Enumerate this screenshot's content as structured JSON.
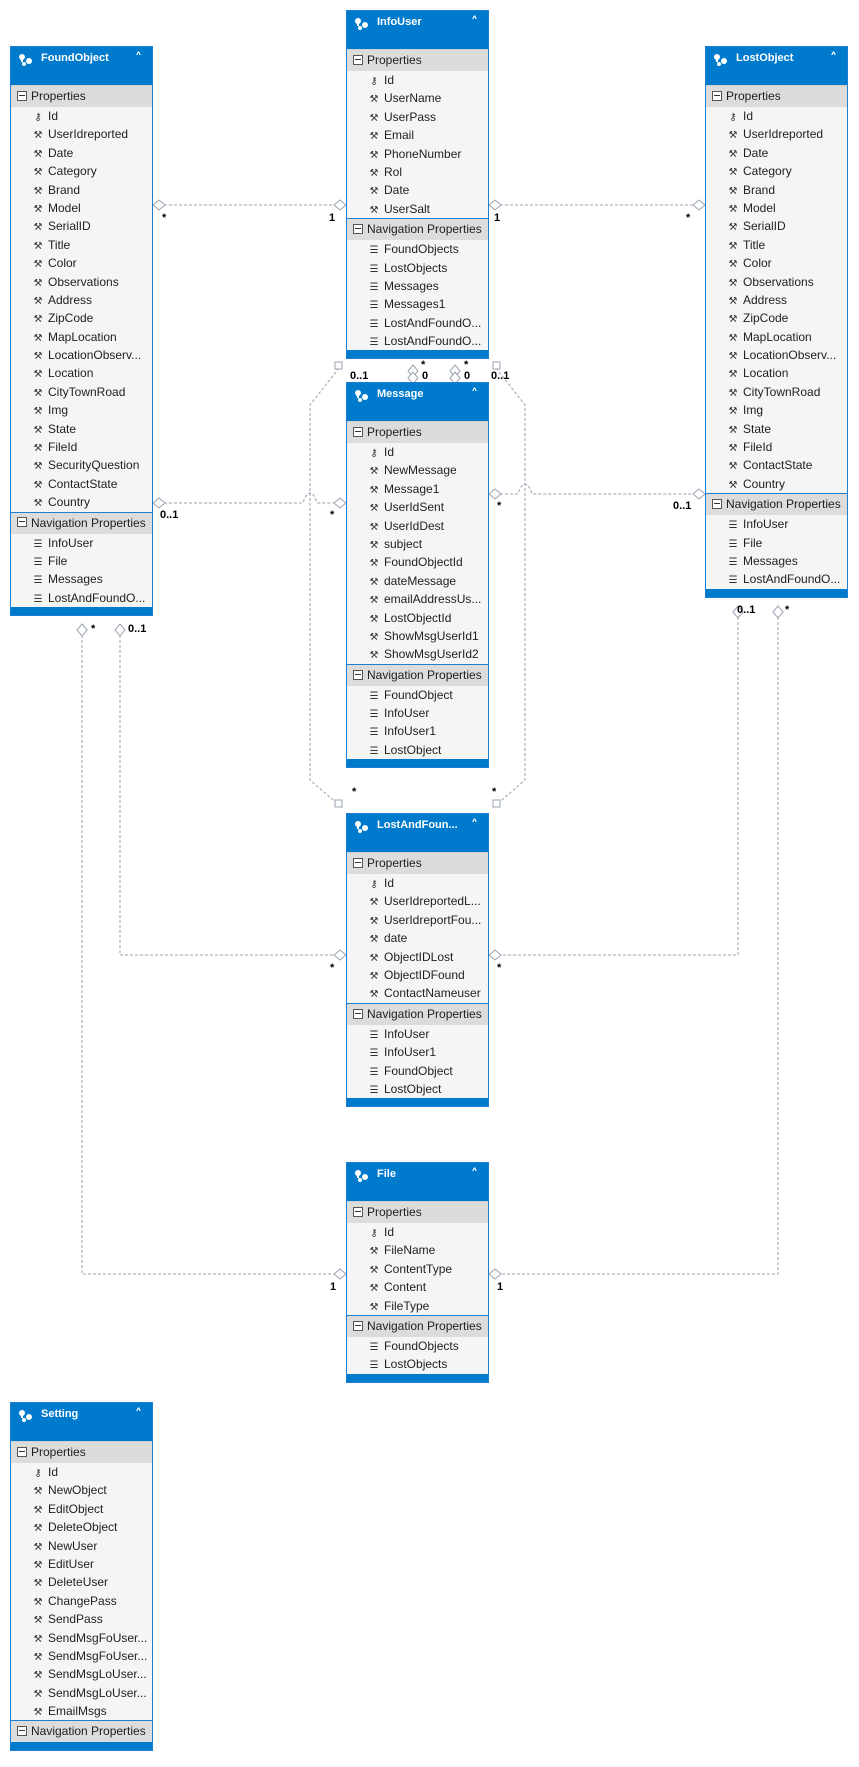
{
  "section_labels": {
    "properties": "Properties",
    "navigation": "Navigation Properties"
  },
  "colors": {
    "header": "#007acc",
    "section": "#dcdcdc",
    "body": "#f5f5f5",
    "connector": "#9aa3b0"
  },
  "entities": {
    "found_object": {
      "title": "FoundObject",
      "properties": [
        "Id",
        "UserIdreported",
        "Date",
        "Category",
        "Brand",
        "Model",
        "SerialID",
        "Title",
        "Color",
        "Observations",
        "Address",
        "ZipCode",
        "MapLocation",
        "LocationObserv...",
        "Location",
        "CityTownRoad",
        "Img",
        "State",
        "FileId",
        "SecurityQuestion",
        "ContactState",
        "Country"
      ],
      "navigation": [
        "InfoUser",
        "File",
        "Messages",
        "LostAndFoundO..."
      ]
    },
    "info_user": {
      "title": "InfoUser",
      "properties": [
        "Id",
        "UserName",
        "UserPass",
        "Email",
        "PhoneNumber",
        "Rol",
        "Date",
        "UserSalt"
      ],
      "navigation": [
        "FoundObjects",
        "LostObjects",
        "Messages",
        "Messages1",
        "LostAndFoundO...",
        "LostAndFoundO..."
      ]
    },
    "lost_object": {
      "title": "LostObject",
      "properties": [
        "Id",
        "UserIdreported",
        "Date",
        "Category",
        "Brand",
        "Model",
        "SerialID",
        "Title",
        "Color",
        "Observations",
        "Address",
        "ZipCode",
        "MapLocation",
        "LocationObserv...",
        "Location",
        "CityTownRoad",
        "Img",
        "State",
        "FileId",
        "ContactState",
        "Country"
      ],
      "navigation": [
        "InfoUser",
        "File",
        "Messages",
        "LostAndFoundO..."
      ]
    },
    "message": {
      "title": "Message",
      "properties": [
        "Id",
        "NewMessage",
        "Message1",
        "UserIdSent",
        "UserIdDest",
        "subject",
        "FoundObjectId",
        "dateMessage",
        "emailAddressUs...",
        "LostObjectId",
        "ShowMsgUserId1",
        "ShowMsgUserId2"
      ],
      "navigation": [
        "FoundObject",
        "InfoUser",
        "InfoUser1",
        "LostObject"
      ]
    },
    "lost_and_found": {
      "title": "LostAndFoun...",
      "properties": [
        "Id",
        "UserIdreportedL...",
        "UserIdreportFou...",
        "date",
        "ObjectIDLost",
        "ObjectIDFound",
        "ContactNameuser"
      ],
      "navigation": [
        "InfoUser",
        "InfoUser1",
        "FoundObject",
        "LostObject"
      ]
    },
    "file": {
      "title": "File",
      "properties": [
        "Id",
        "FileName",
        "ContentType",
        "Content",
        "FileType"
      ],
      "navigation": [
        "FoundObjects",
        "LostObjects"
      ]
    },
    "setting": {
      "title": "Setting",
      "properties": [
        "Id",
        "NewObject",
        "EditObject",
        "DeleteObject",
        "NewUser",
        "EditUser",
        "DeleteUser",
        "ChangePass",
        "SendPass",
        "SendMsgFoUser...",
        "SendMsgFoUser...",
        "SendMsgLoUser...",
        "SendMsgLoUser...",
        "EmailMsgs"
      ],
      "navigation": []
    }
  },
  "multiplicities": {
    "found_info_found": "*",
    "found_info_info": "1",
    "lost_info_info": "1",
    "lost_info_lost": "*",
    "found_msg_found": "0..1",
    "found_msg_msg": "*",
    "lost_msg_msg": "*",
    "lost_msg_lost": "0..1",
    "info_msg_a": "0..1",
    "info_msg_b_top": "*",
    "info_msg_b": "0",
    "info_msg_c_top": "*",
    "info_msg_c": "0",
    "info_msg_d": "0..1",
    "laf_left_top": "*",
    "laf_right_top": "*",
    "found_laf_found": "0..1",
    "found_laf_laf": "*",
    "lost_laf_lost": "0..1",
    "lost_laf_laf": "*",
    "found_file_found": "*",
    "found_file_file": "1",
    "lost_file_lost": "*",
    "lost_file_file": "1"
  }
}
